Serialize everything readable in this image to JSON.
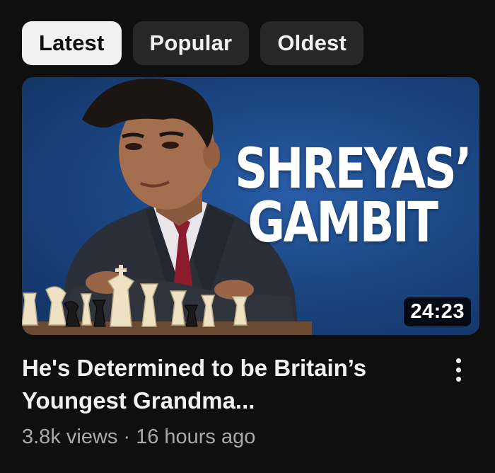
{
  "filters": {
    "chips": [
      {
        "label": "Latest",
        "active": true
      },
      {
        "label": "Popular",
        "active": false
      },
      {
        "label": "Oldest",
        "active": false
      }
    ]
  },
  "video": {
    "thumbnail": {
      "title_line1": "SHREYAS’",
      "title_line2": "GAMBIT",
      "duration": "24:23"
    },
    "title": "He's Determined to be Britain’s Youngest Grandma...",
    "views": "3.8k views",
    "separator": "·",
    "age": "16 hours ago",
    "menu_icon": "more-vertical-icon"
  },
  "colors": {
    "background": "#0f0f0f",
    "chip_active_bg": "#f1f1f1",
    "chip_bg": "#272727",
    "thumb_blue": "#1b4784",
    "meta_text": "#aaaaaa"
  }
}
